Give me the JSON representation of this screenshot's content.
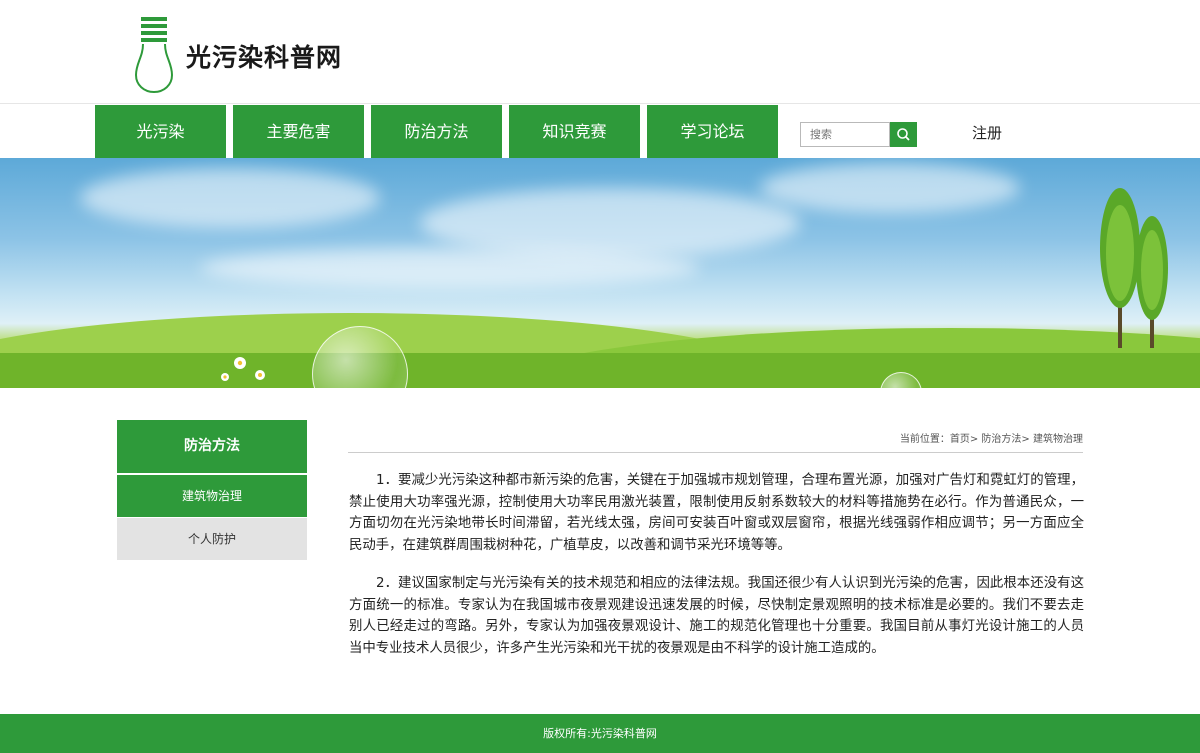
{
  "site": {
    "title": "光污染科普网",
    "logo_icon": "light-bulb-icon",
    "brand_color": "#2e9a3a"
  },
  "nav": {
    "items": [
      "光污染",
      "主要危害",
      "防治方法",
      "知识竞赛",
      "学习论坛"
    ],
    "search_placeholder": "搜索",
    "search_icon": "search-icon",
    "register_label": "注册"
  },
  "sidebar": {
    "title": "防治方法",
    "items": [
      "建筑物治理",
      "个人防护"
    ],
    "active_index": 0
  },
  "content": {
    "breadcrumb": "当前位置：首页> 防治方法> 建筑物治理",
    "paragraphs": [
      "1．要减少光污染这种都市新污染的危害，关键在于加强城市规划管理，合理布置光源，加强对广告灯和霓虹灯的管理，禁止使用大功率强光源，控制使用大功率民用激光装置，限制使用反射系数较大的材料等措施势在必行。作为普通民众，一方面切勿在光污染地带长时间滞留，若光线太强，房间可安装百叶窗或双层窗帘，根据光线强弱作相应调节；另一方面应全民动手，在建筑群周围栽树种花，广植草皮，以改善和调节采光环境等等。",
      "2．建议国家制定与光污染有关的技术规范和相应的法律法规。我国还很少有人认识到光污染的危害，因此根本还没有这方面统一的标准。专家认为在我国城市夜景观建设迅速发展的时候，尽快制定景观照明的技术标准是必要的。我们不要去走别人已经走过的弯路。另外，专家认为加强夜景观设计、施工的规范化管理也十分重要。我国目前从事灯光设计施工的人员当中专业技术人员很少，许多产生光污染和光干扰的夜景观是由不科学的设计施工造成的。"
    ]
  },
  "footer": {
    "copyright": "版权所有:光污染科普网"
  }
}
